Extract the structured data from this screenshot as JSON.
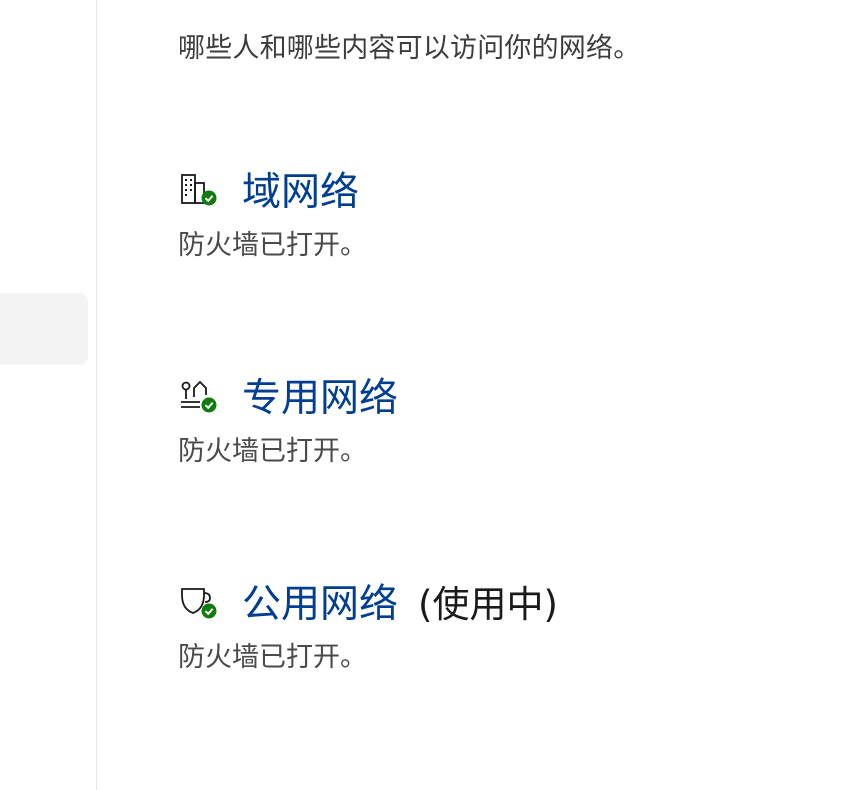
{
  "intro_text": "哪些人和哪些内容可以访问你的网络。",
  "networks": [
    {
      "name": "域网络",
      "icon": "domain-network-icon",
      "status": "防火墙已打开。",
      "in_use": ""
    },
    {
      "name": "专用网络",
      "icon": "private-network-icon",
      "status": "防火墙已打开。",
      "in_use": ""
    },
    {
      "name": "公用网络",
      "icon": "public-network-icon",
      "status": "防火墙已打开。",
      "in_use": "(使用中)"
    }
  ],
  "colors": {
    "link": "#003e92",
    "check": "#107c10",
    "text": "#3d3d3d"
  }
}
